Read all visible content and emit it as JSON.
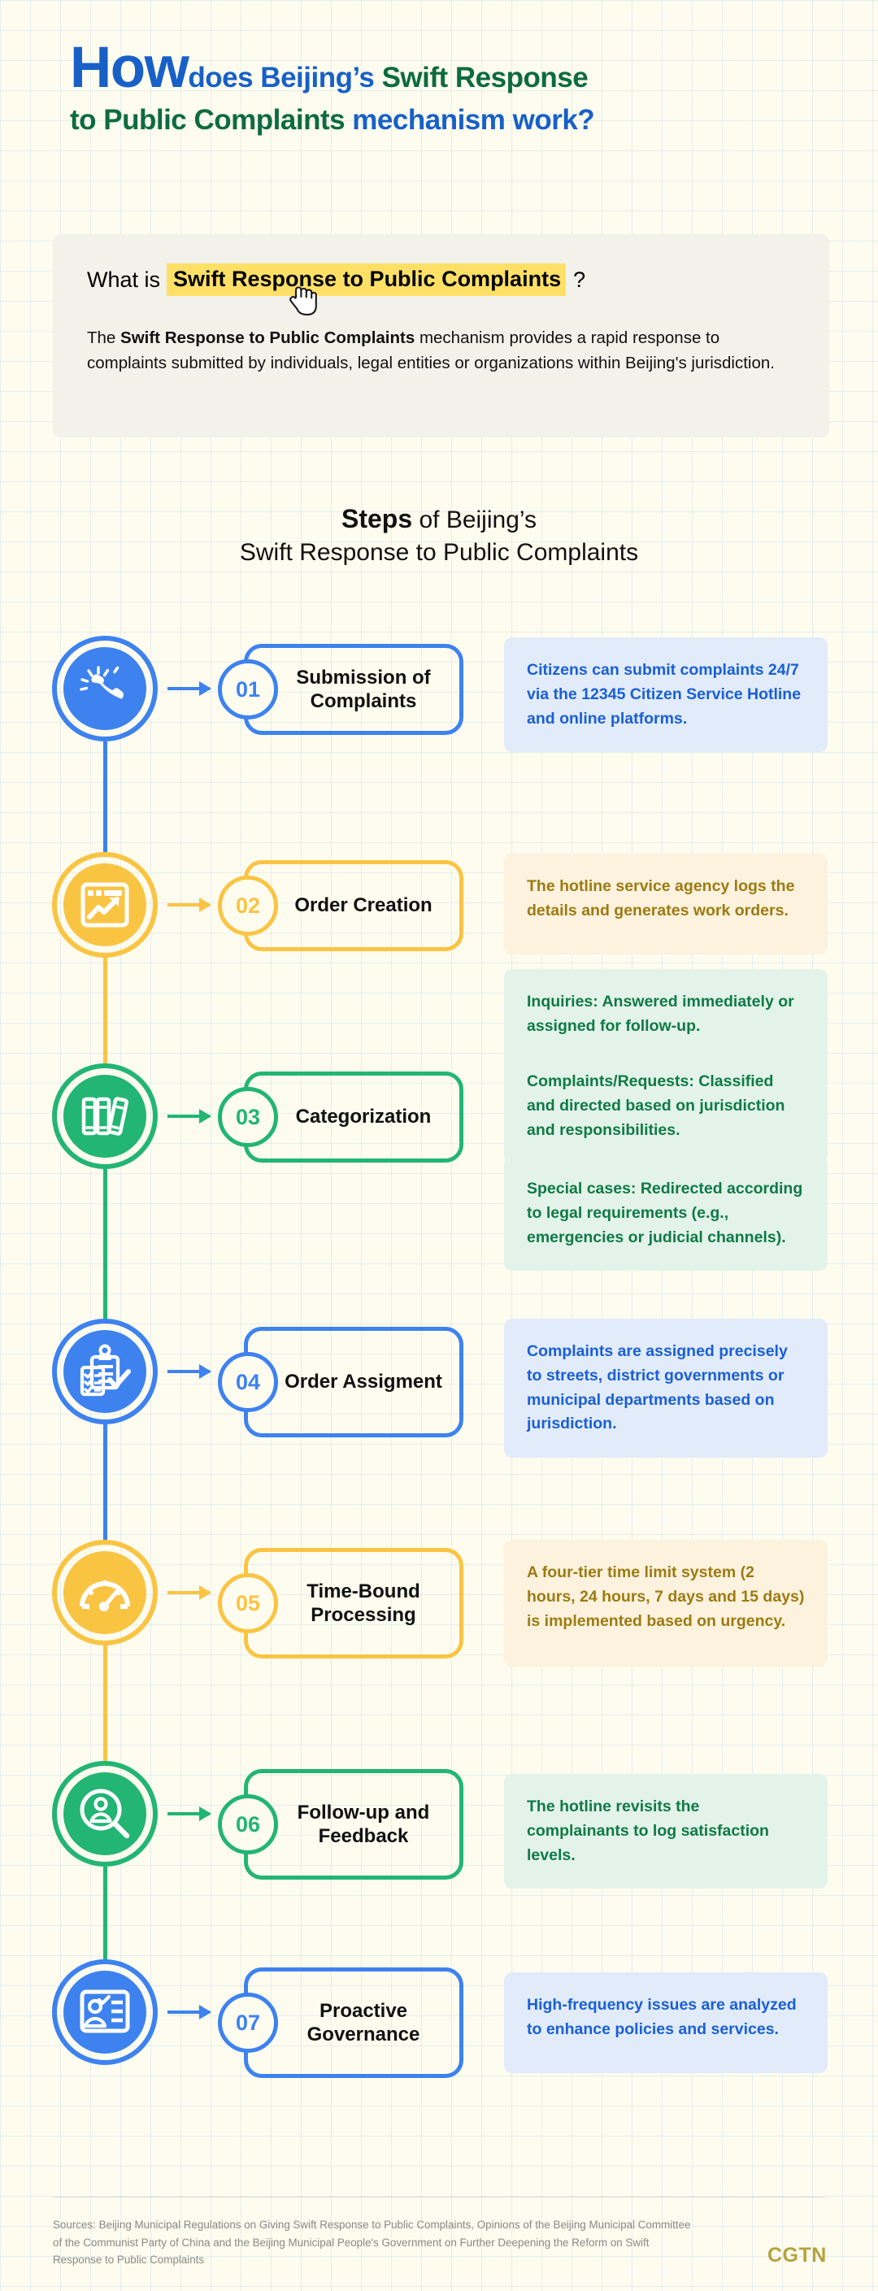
{
  "title": {
    "how": "How",
    "part_blue_1": "does Beijing’s ",
    "part_green_1": "Swift Response",
    "part_green_2": "to Public Complaints ",
    "part_blue_2": "mechanism work?"
  },
  "whatis": {
    "lead": "What is",
    "highlight": "Swift Response to Public Complaints",
    "qmark": "?",
    "body_pre": "The ",
    "body_bold": "Swift Response to Public Complaints",
    "body_post": " mechanism provides a rapid response to complaints submitted by individuals, legal entities or organizations within Beijing's jurisdiction.",
    "cursor_icon": "hand-pointer-icon"
  },
  "steps_heading": {
    "bold": "Steps",
    "rest": " of Beijing’s",
    "line2": "Swift Response to Public Complaints"
  },
  "colors": {
    "blue": "#3d82ef",
    "yellow": "#fac443",
    "green": "#22b573",
    "blue_note_bg": "#e1ebfa",
    "yellow_note_bg": "#fcf2dd",
    "green_note_bg": "#e3f3ea",
    "blue_note_text": "#1a5fd6",
    "yellow_note_text": "#9d7b12",
    "green_note_text": "#0f7a45",
    "background": "#fdfcef",
    "panel": "#f2f1ea",
    "highlight": "#ffe066",
    "cgtn": "#b6a33d"
  },
  "steps": [
    {
      "number": "01",
      "label": "Submission of Complaints",
      "icon": "phone-ringing-icon",
      "color": "blue",
      "notes": [
        "Citizens can submit complaints 24/7 via the 12345 Citizen Service Hotline and online platforms."
      ]
    },
    {
      "number": "02",
      "label": "Order Creation",
      "icon": "browser-chart-icon",
      "color": "yellow",
      "notes": [
        "The hotline service agency logs the details and generates work orders."
      ]
    },
    {
      "number": "03",
      "label": "Categorization",
      "icon": "books-icon",
      "color": "green",
      "notes": [
        "Inquiries: Answered immediately or assigned for follow-up.",
        "Complaints/Requests: Classified and directed based on jurisdiction and responsibilities.",
        "Special cases: Redirected according to legal requirements (e.g., emergencies or judicial channels)."
      ]
    },
    {
      "number": "04",
      "label": "Order Assigment",
      "icon": "clipboard-checklist-icon",
      "color": "blue",
      "notes": [
        "Complaints are assigned precisely to streets, district governments or municipal departments based on jurisdiction."
      ]
    },
    {
      "number": "05",
      "label": "Time-Bound Processing",
      "icon": "gauge-icon",
      "color": "yellow",
      "notes": [
        "A four-tier time limit system (2 hours, 24 hours, 7 days and 15 days) is implemented based on urgency."
      ]
    },
    {
      "number": "06",
      "label": "Follow-up and Feedback",
      "icon": "user-magnifier-icon",
      "color": "green",
      "notes": [
        "The hotline revisits the complainants to log satisfaction levels."
      ]
    },
    {
      "number": "07",
      "label": "Proactive Governance",
      "icon": "id-card-icon",
      "color": "blue",
      "notes": [
        "High-frequency issues are analyzed to enhance policies and services."
      ]
    }
  ],
  "footer": {
    "sources": "Sources: Beijing Municipal Regulations on Giving Swift Response to Public Complaints, Opinions of the Beijing Municipal Committee of the Communist Party of China and the Beijing Municipal People's Government on Further Deepening the Reform on Swift Response to Public Complaints",
    "logo": "CGTN"
  }
}
